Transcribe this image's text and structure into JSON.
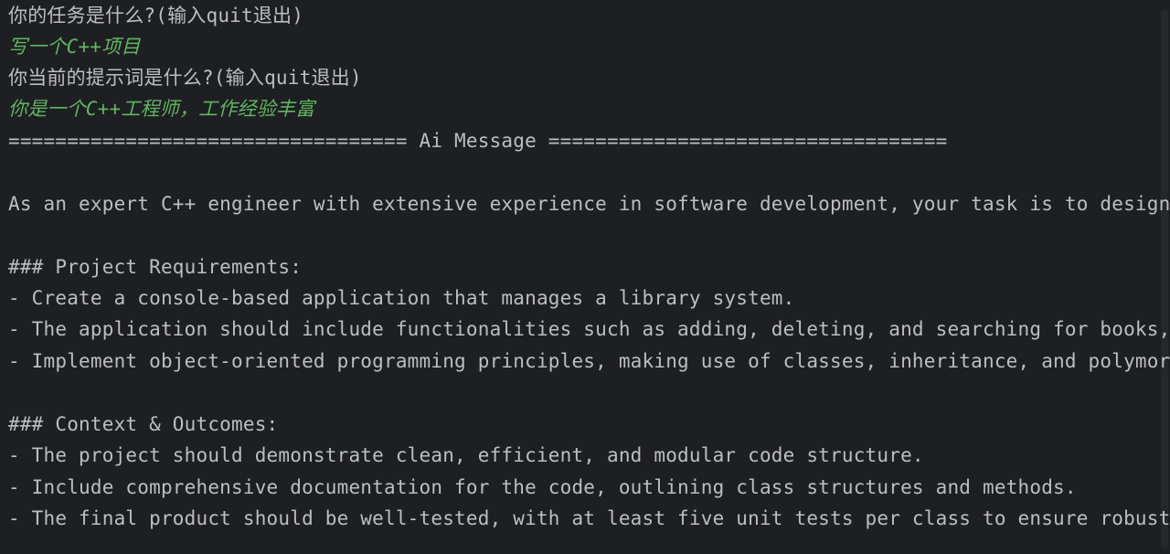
{
  "console": {
    "prompt_task": "你的任务是什么?(输入quit退出)",
    "input_task": "写一个C++项目",
    "prompt_system": "你当前的提示词是什么?(输入quit退出)",
    "input_system": "你是一个C++工程师，工作经验丰富",
    "separator": "================================== Ai Message ==================================",
    "intro": "As an expert C++ engineer with extensive experience in software development, your task is to design a",
    "heading_requirements": "### Project Requirements:",
    "req_1": "- Create a console-based application that manages a library system.",
    "req_2": "- The application should include functionalities such as adding, deleting, and searching for books, a",
    "req_3": "- Implement object-oriented programming principles, making use of classes, inheritance, and polymorph",
    "heading_context": "### Context & Outcomes:",
    "ctx_1": "- The project should demonstrate clean, efficient, and modular code structure.",
    "ctx_2": "- Include comprehensive documentation for the code, outlining class structures and methods.",
    "ctx_3": "- The final product should be well-tested, with at least five unit tests per class to ensure robustne"
  },
  "colors": {
    "background": "#1e1f22",
    "text": "#bcbec4",
    "user_input": "#5fb760"
  }
}
